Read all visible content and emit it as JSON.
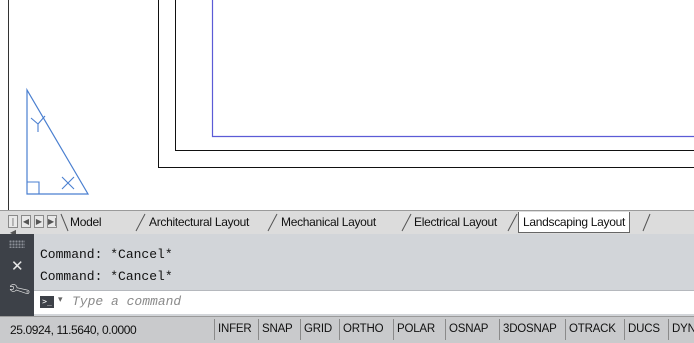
{
  "tabs": {
    "nav": [
      "|◀",
      "◀",
      "▶",
      "▶|"
    ],
    "items": [
      {
        "label": "Model"
      },
      {
        "label": "Architectural Layout"
      },
      {
        "label": "Mechanical Layout"
      },
      {
        "label": "Electrical Layout"
      },
      {
        "label": "Landscaping Layout",
        "active": true
      }
    ]
  },
  "command": {
    "history": [
      "Command: *Cancel*",
      "Command: *Cancel*"
    ],
    "placeholder": "Type a command"
  },
  "status": {
    "coordinates": "25.0924, 11.5640, 0.0000",
    "toggles": [
      "INFER",
      "SNAP",
      "GRID",
      "ORTHO",
      "POLAR",
      "OSNAP",
      "3DOSNAP",
      "OTRACK",
      "DUCS",
      "DYN"
    ]
  },
  "colors": {
    "viewport_line": "#5b5bd6",
    "ucs_icon": "#4a7fd0",
    "border_line": "#111111"
  },
  "icons": {
    "ucs": "ucs-triangle-icon",
    "close": "close-icon",
    "customize": "wrench-icon",
    "prompt": "command-prompt-icon"
  }
}
